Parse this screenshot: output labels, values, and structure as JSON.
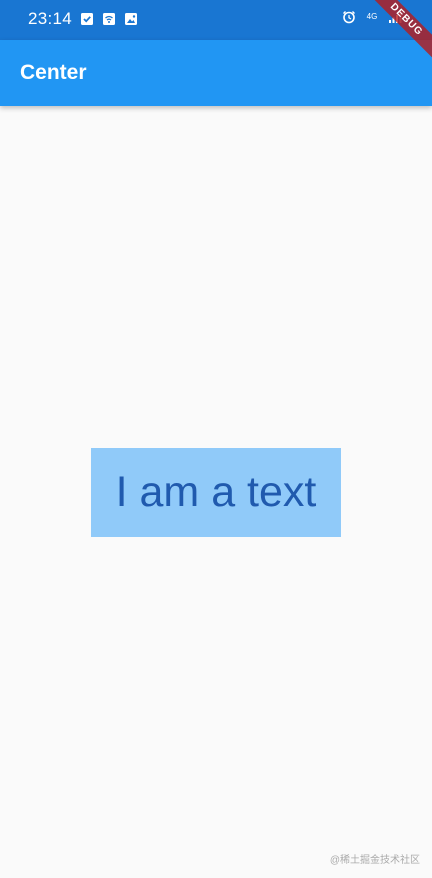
{
  "status_bar": {
    "time": "23:14",
    "network": "4G",
    "icons_left": [
      "check-icon",
      "wifi-icon",
      "image-icon"
    ],
    "icons_right": [
      "alarm-icon",
      "signal-icon",
      "battery-icon"
    ],
    "background": "#1976d2"
  },
  "app_bar": {
    "title": "Center",
    "background": "#2196f3"
  },
  "debug_banner": "DEBUG",
  "main": {
    "text": "I am a text",
    "box_color": "#90caf9",
    "text_color": "#0d47a1"
  },
  "watermark": "@稀土掘金技术社区"
}
